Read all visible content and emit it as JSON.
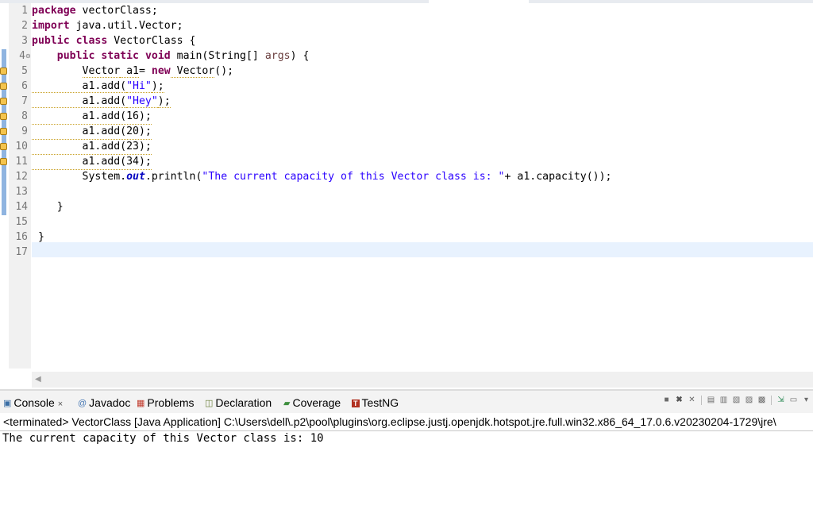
{
  "editor": {
    "line_numbers": [
      "1",
      "2",
      "3",
      "4",
      "5",
      "6",
      "7",
      "8",
      "9",
      "10",
      "11",
      "12",
      "13",
      "14",
      "15",
      "16",
      "17"
    ],
    "fold_marker": "⊖",
    "code": {
      "l1_kw": "package",
      "l1_rest": " vectorClass;",
      "l2_kw": "import",
      "l2_rest": " java.util.Vector;",
      "l3_kw1": "public",
      "l3_sp": " ",
      "l3_kw2": "class",
      "l3_rest": " VectorClass {",
      "l4_indent": "    ",
      "l4_kw1": "public",
      "l4_kw2": "static",
      "l4_kw3": "void",
      "l4_mid": " main(String[] ",
      "l4_param": "args",
      "l4_end": ") {",
      "l5_indent": "        ",
      "l5_type": "Vector",
      "l5_var": " a1",
      "l5_eq": "= ",
      "l5_kw": "new",
      "l5_ctor": " Vector",
      "l5_end": "();",
      "l6_pre": "        a1.add(",
      "l6_str": "\"Hi\"",
      "l6_end": ");",
      "l7_pre": "        a1.add(",
      "l7_str": "\"Hey\"",
      "l7_end": ");",
      "l8": "        a1.add(16);",
      "l9": "        a1.add(20);",
      "l10": "        a1.add(23);",
      "l11": "        a1.add(34);",
      "l12_pre": "        System.",
      "l12_fld": "out",
      "l12_mid": ".println(",
      "l12_str": "\"The current capacity of this Vector class is: \"",
      "l12_end": "+ a1.capacity());",
      "l14": "    }",
      "l16": " }"
    }
  },
  "console": {
    "tabs": [
      {
        "label": "Console",
        "icon": "console-icon"
      },
      {
        "label": "Javadoc",
        "icon": "javadoc-icon"
      },
      {
        "label": "Problems",
        "icon": "problems-icon"
      },
      {
        "label": "Declaration",
        "icon": "declaration-icon"
      },
      {
        "label": "Coverage",
        "icon": "coverage-icon"
      },
      {
        "label": "TestNG",
        "icon": "testng-icon"
      }
    ],
    "close_glyph": "×",
    "status_line": "<terminated> VectorClass [Java Application] C:\\Users\\dell\\.p2\\pool\\plugins\\org.eclipse.justj.openjdk.hotspot.jre.full.win32.x86_64_17.0.6.v20230204-1729\\jre\\",
    "output": "The current capacity of this Vector class is: 10"
  }
}
